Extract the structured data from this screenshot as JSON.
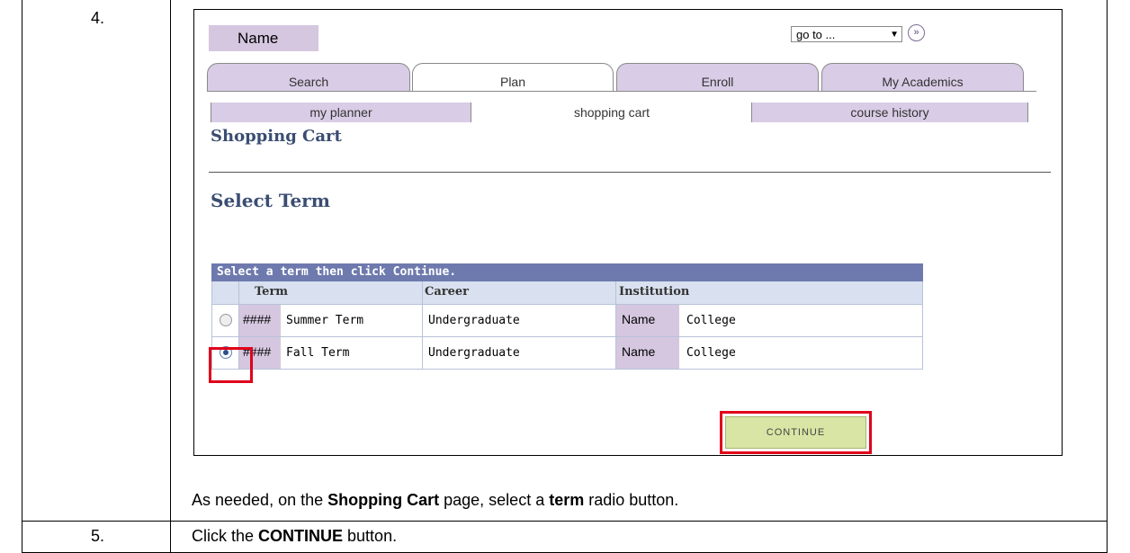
{
  "steps": [
    {
      "number": "4.",
      "instruction": {
        "pre": "As needed, on the ",
        "bold1": "Shopping Cart",
        "mid": " page, select a ",
        "bold2": "term",
        "post": " radio button."
      }
    },
    {
      "number": "5.",
      "instruction": {
        "pre": "Click the ",
        "bold1": "CONTINUE",
        "post": " button."
      }
    }
  ],
  "screenshot": {
    "name_label": "Name",
    "goto": {
      "value": "go to ...",
      "arrow_icon": "dropdown-arrow-icon",
      "go_icon": "double-chevron-right-icon"
    },
    "tabs": [
      {
        "label": "Search",
        "active": false
      },
      {
        "label": "Plan",
        "active": true
      },
      {
        "label": "Enroll",
        "active": false
      },
      {
        "label": "My Academics",
        "active": false
      }
    ],
    "subtabs": [
      {
        "label": "my planner",
        "active": false
      },
      {
        "label": "shopping cart",
        "active": true
      },
      {
        "label": "course history",
        "active": false
      }
    ],
    "page_title": "Shopping Cart",
    "section_title": "Select Term",
    "grid": {
      "caption": "Select a term then click Continue.",
      "headers": [
        "Term",
        "Career",
        "Institution"
      ],
      "rows": [
        {
          "selected": false,
          "term_code": "####",
          "term": "Summer Term",
          "career": "Undergraduate",
          "inst_code": "Name",
          "institution": "College"
        },
        {
          "selected": true,
          "term_code": "####",
          "term": "Fall Term",
          "career": "Undergraduate",
          "inst_code": "Name",
          "institution": "College"
        }
      ]
    },
    "continue_label": "CONTINUE",
    "highlight_color": "#e0001a"
  }
}
